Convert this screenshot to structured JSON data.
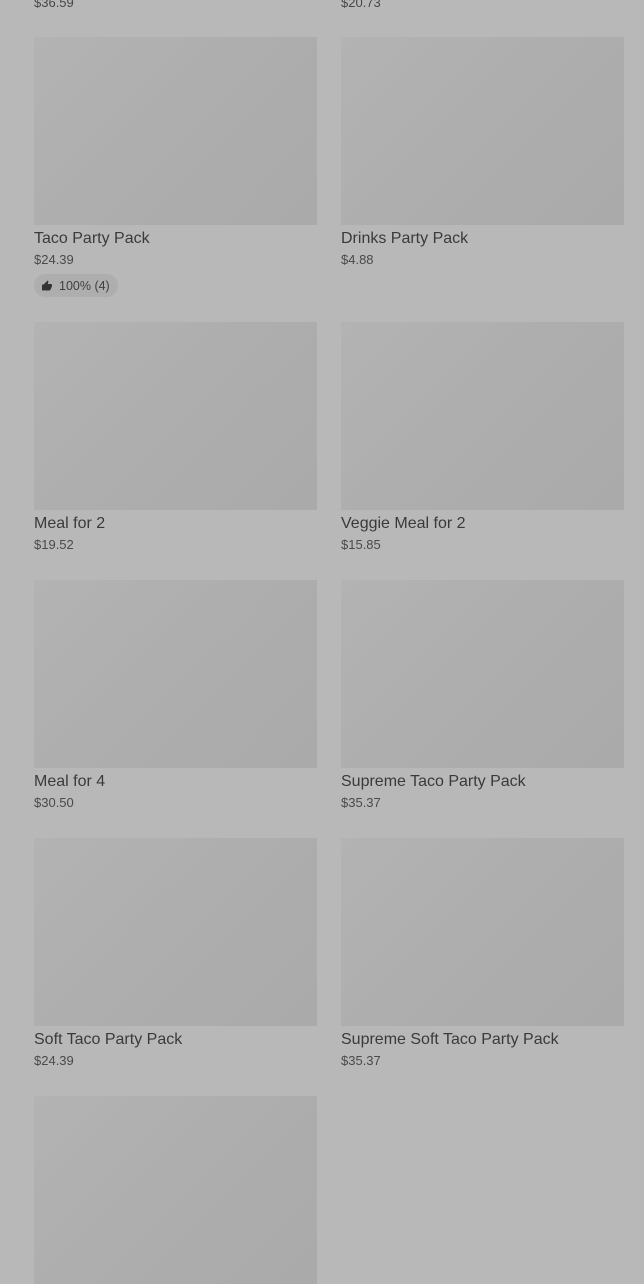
{
  "top_prices": {
    "left": "$36.59",
    "right": "$20.73"
  },
  "items": [
    {
      "title": "Taco Party Pack",
      "price": "$24.39",
      "rating": "100% (4)"
    },
    {
      "title": "Drinks Party Pack",
      "price": "$4.88"
    },
    {
      "title": "Meal for 2",
      "price": "$19.52"
    },
    {
      "title": "Veggie Meal for 2",
      "price": "$15.85"
    },
    {
      "title": "Meal for 4",
      "price": "$30.50"
    },
    {
      "title": "Supreme Taco Party Pack",
      "price": "$35.37"
    },
    {
      "title": "Soft Taco Party Pack",
      "price": "$24.39"
    },
    {
      "title": "Supreme Soft Taco Party Pack",
      "price": "$35.37"
    }
  ],
  "icons": {
    "rating": "thumbs-up-icon"
  }
}
